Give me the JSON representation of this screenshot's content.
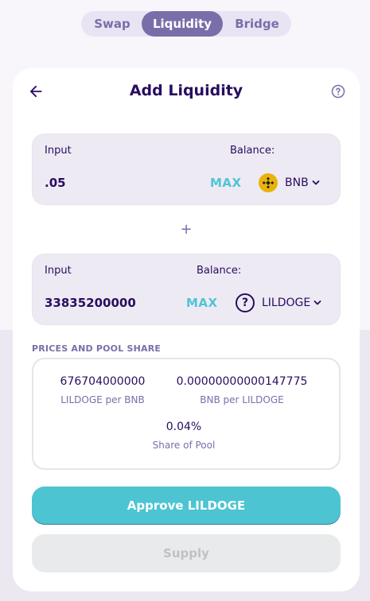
{
  "nav": {
    "tabs": [
      {
        "label": "Swap"
      },
      {
        "label": "Liquidity",
        "active": true
      },
      {
        "label": "Bridge"
      }
    ]
  },
  "header": {
    "title": "Add Liquidity",
    "back_icon": "arrow-left-icon",
    "help_icon": "question-circle-icon"
  },
  "input1": {
    "label": "Input",
    "balance_label": "Balance:",
    "value": ".05",
    "max_label": "MAX",
    "token_symbol": "BNB",
    "token_icon": "bnb-logo-icon"
  },
  "plus": "+",
  "input2": {
    "label": "Input",
    "balance_label": "Balance:",
    "value": "33835200000",
    "max_label": "MAX",
    "token_symbol": "LILDOGE",
    "token_icon": "unknown-token-icon",
    "token_glyph": "?"
  },
  "prices": {
    "section_label": "PRICES AND POOL SHARE",
    "price1_value": "676704000000",
    "price1_caption": "LILDOGE per BNB",
    "price2_value": "0.00000000000147775",
    "price2_caption": "BNB per LILDOGE",
    "share_value": "0.04%",
    "share_caption": "Share of Pool"
  },
  "buttons": {
    "approve_label": "Approve LILDOGE",
    "supply_label": "Supply"
  },
  "colors": {
    "primary": "#7a6eaa",
    "accent": "#4dc4d2",
    "text": "#280d5f",
    "bnb": "#e8b30b"
  }
}
